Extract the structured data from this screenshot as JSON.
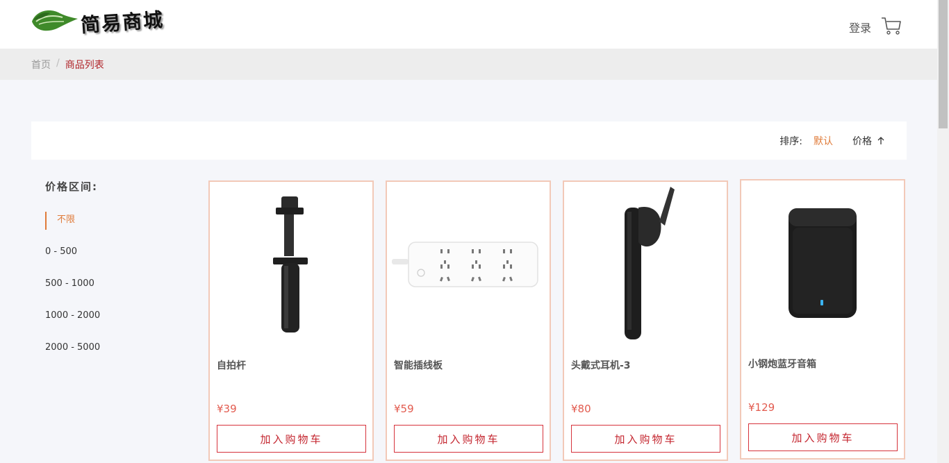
{
  "header": {
    "logo_text": "简易商城",
    "login_label": "登录"
  },
  "breadcrumb": {
    "home": "首页",
    "separator": "/",
    "current": "商品列表"
  },
  "sort": {
    "label": "排序:",
    "default": "默认",
    "price": "价格"
  },
  "filter": {
    "title": "价格区间:",
    "options": [
      "不限",
      "0 - 500",
      "500 - 1000",
      "1000 - 2000",
      "2000 - 5000"
    ],
    "selected": "不限"
  },
  "products": [
    {
      "name": "自拍杆",
      "price": "¥39",
      "button": "加入购物车",
      "image_icon": "selfie-stick-icon"
    },
    {
      "name": "智能插线板",
      "price": "¥59",
      "button": "加入购物车",
      "image_icon": "power-strip-icon"
    },
    {
      "name": "头戴式耳机-3",
      "price": "¥80",
      "button": "加入购物车",
      "image_icon": "bluetooth-earpiece-icon"
    },
    {
      "name": "小钢炮蓝牙音箱",
      "price": "¥129",
      "button": "加入购物车",
      "image_icon": "bluetooth-speaker-icon"
    }
  ],
  "colors": {
    "accent": "#e07b39",
    "brand_red": "#c4262f",
    "price_red": "#e25a4e",
    "card_border": "#f2c9b8"
  }
}
